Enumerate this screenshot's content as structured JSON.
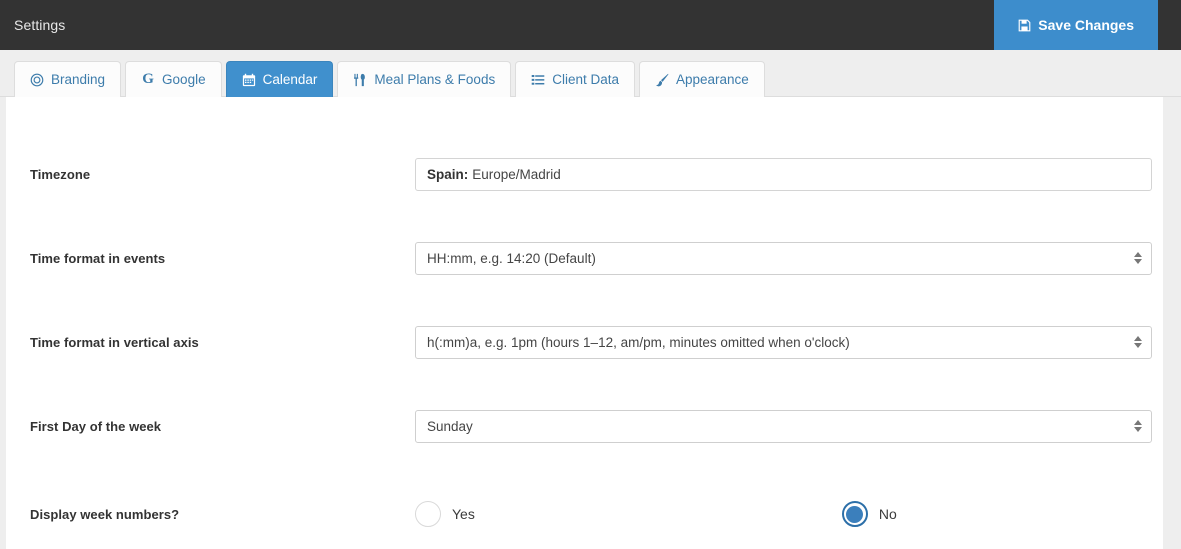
{
  "topbar": {
    "title": "Settings",
    "save_label": "Save Changes",
    "save_icon": "save-floppy-icon",
    "background": "#333333",
    "button_color": "#3d8dcc"
  },
  "tabs": [
    {
      "label": "Branding",
      "icon": "copyright-icon",
      "active": false
    },
    {
      "label": "Google",
      "icon": "google-g-icon",
      "active": false
    },
    {
      "label": "Calendar",
      "icon": "calendar-icon",
      "active": true
    },
    {
      "label": "Meal Plans & Foods",
      "icon": "cutlery-icon",
      "active": false
    },
    {
      "label": "Client Data",
      "icon": "list-icon",
      "active": false
    },
    {
      "label": "Appearance",
      "icon": "paintbrush-icon",
      "active": false
    }
  ],
  "form": {
    "timezone": {
      "label": "Timezone",
      "country": "Spain:",
      "value": "Europe/Madrid"
    },
    "time_format_events": {
      "label": "Time format in events",
      "value": "HH:mm, e.g. 14:20 (Default)"
    },
    "time_format_axis": {
      "label": "Time format in vertical axis",
      "value": "h(:mm)a, e.g. 1pm (hours 1–12, am/pm, minutes omitted when o'clock)"
    },
    "first_day": {
      "label": "First Day of the week",
      "value": "Sunday"
    },
    "week_numbers": {
      "label": "Display week numbers?",
      "yes_label": "Yes",
      "no_label": "No",
      "selected": "No"
    }
  },
  "colors": {
    "accent": "#4090cd",
    "header": "#333333",
    "page_bg": "#eeeeee",
    "radio_selected": "#3b7fbc"
  }
}
